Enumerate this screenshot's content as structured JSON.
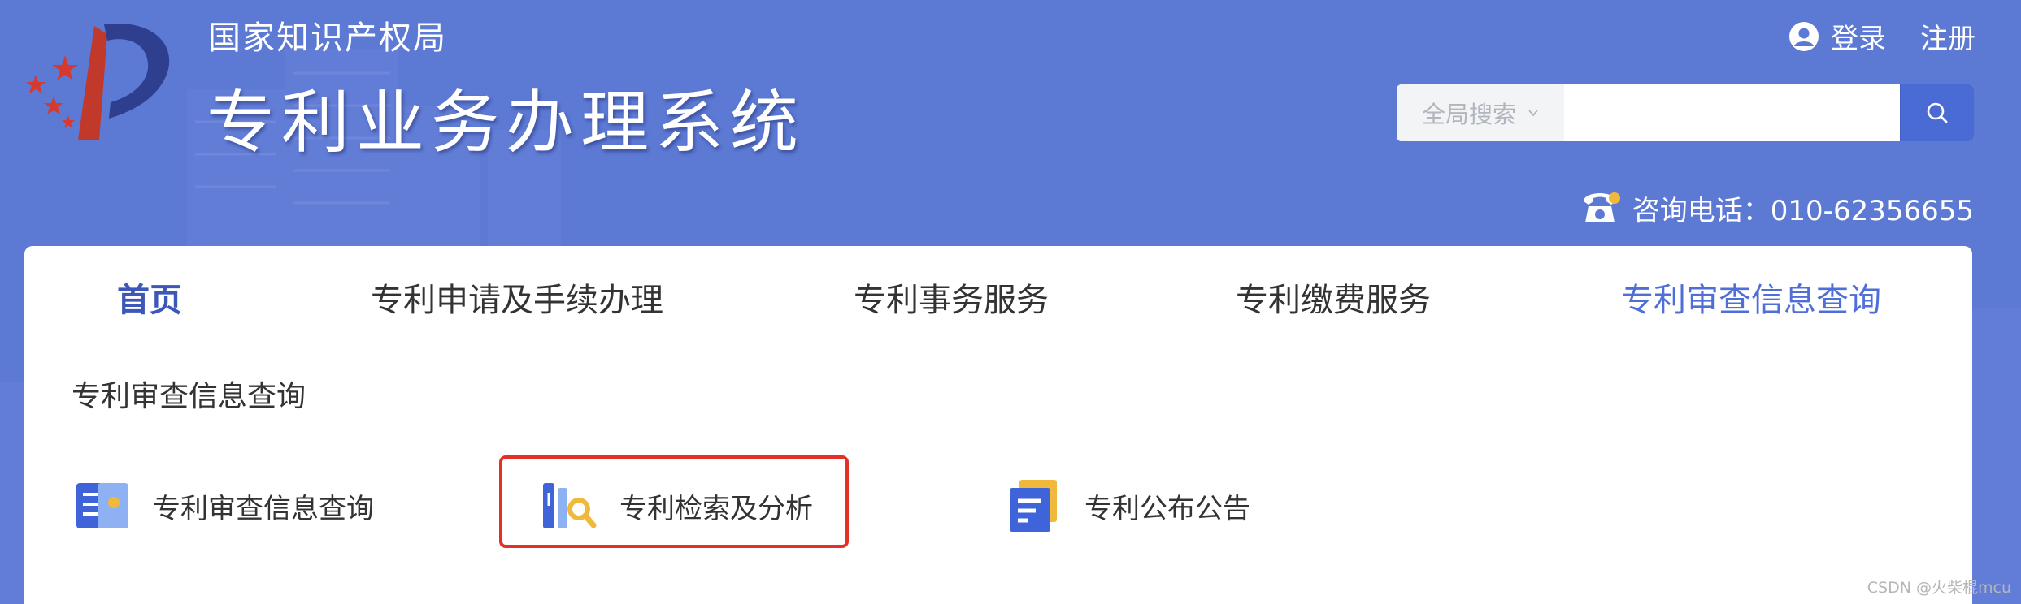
{
  "header": {
    "org_name": "国家知识产权局",
    "system_name": "专利业务办理系统",
    "login_label": "登录",
    "register_label": "注册",
    "search": {
      "scope_label": "全局搜索",
      "placeholder": "",
      "value": ""
    },
    "hotline_text": "咨询电话：010-62356655"
  },
  "nav": {
    "items": [
      {
        "label": "首页"
      },
      {
        "label": "专利申请及手续办理"
      },
      {
        "label": "专利事务服务"
      },
      {
        "label": "专利缴费服务"
      },
      {
        "label": "专利审查信息查询"
      }
    ],
    "active_index": 4
  },
  "section": {
    "title": "专利审查信息查询",
    "cards": [
      {
        "label": "专利审查信息查询",
        "icon": "document-query-icon"
      },
      {
        "label": "专利检索及分析",
        "icon": "search-analysis-icon"
      },
      {
        "label": "专利公布公告",
        "icon": "announcement-icon"
      }
    ],
    "highlighted_card_index": 1
  },
  "watermark": "CSDN @火柴棍mcu",
  "colors": {
    "header_bg": "#5c79d4",
    "accent": "#4f6fd6",
    "highlight_border": "#e53027"
  }
}
